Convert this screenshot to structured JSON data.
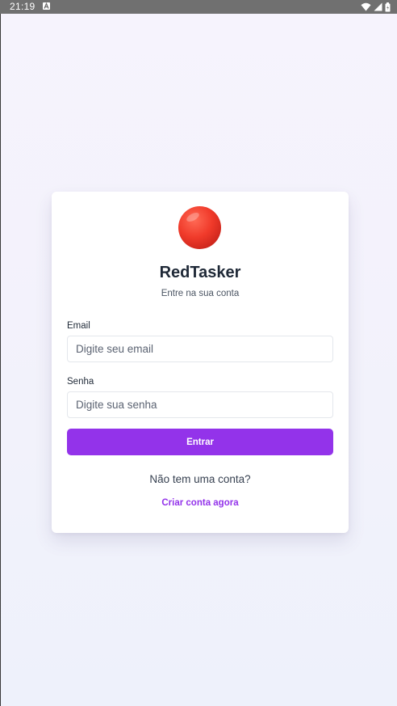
{
  "status_bar": {
    "time": "21:19"
  },
  "app": {
    "logo_icon": "red-circle-emoji",
    "title": "RedTasker",
    "subtitle": "Entre na sua conta"
  },
  "form": {
    "email_label": "Email",
    "email_placeholder": "Digite seu email",
    "email_value": "",
    "password_label": "Senha",
    "password_placeholder": "Digite sua senha",
    "password_value": "",
    "submit_label": "Entrar"
  },
  "footer": {
    "prompt": "Não tem uma conta?",
    "link_label": "Criar conta agora"
  },
  "colors": {
    "accent": "#9333ea",
    "logo": "#ef3b2c",
    "title": "#1f2937",
    "status_bar": "#707070"
  }
}
